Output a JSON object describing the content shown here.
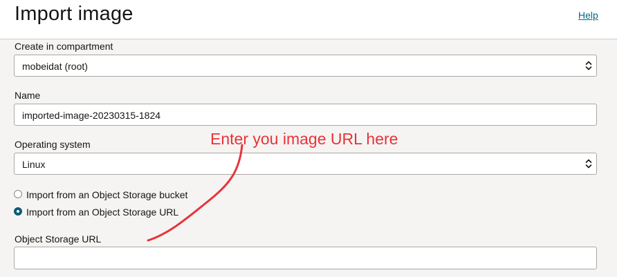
{
  "header": {
    "title": "Import image",
    "help_link": "Help"
  },
  "form": {
    "compartment": {
      "label": "Create in compartment",
      "value": "mobeidat (root)"
    },
    "name": {
      "label": "Name",
      "value": "imported-image-20230315-1824"
    },
    "operating_system": {
      "label": "Operating system",
      "value": "Linux"
    },
    "source": {
      "options": [
        {
          "label": "Import from an Object Storage bucket",
          "selected": false
        },
        {
          "label": "Import from an Object Storage URL",
          "selected": true
        }
      ]
    },
    "object_storage_url": {
      "label": "Object Storage URL",
      "value": ""
    }
  },
  "annotation": {
    "text": "Enter you image URL here",
    "color": "#e8333a"
  },
  "colors": {
    "accent": "#0b5c79",
    "link": "#00688c",
    "background": "#f5f4f2"
  }
}
